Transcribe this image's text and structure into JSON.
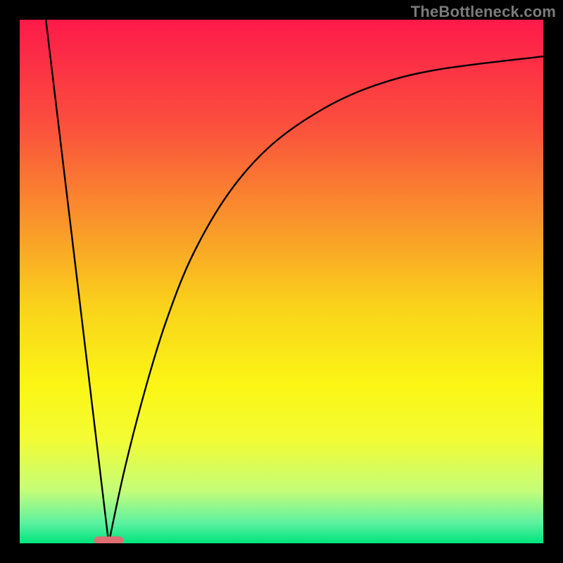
{
  "watermark": "TheBottleneck.com",
  "chart_data": {
    "type": "line",
    "title": "",
    "xlabel": "",
    "ylabel": "",
    "xlim": [
      0,
      100
    ],
    "ylim": [
      0,
      100
    ],
    "optimum_x": 17,
    "series": [
      {
        "name": "left-descent",
        "comment": "Linear segment dropping from top-left down to the optimum point",
        "points": [
          {
            "x": 5.0,
            "y": 100.0
          },
          {
            "x": 17.0,
            "y": 0.0
          }
        ]
      },
      {
        "name": "right-ascent",
        "comment": "Curved segment rising from the optimum toward the upper-right, flattening out near ~93",
        "points": [
          {
            "x": 17.0,
            "y": 0.0
          },
          {
            "x": 20.0,
            "y": 14.0
          },
          {
            "x": 24.0,
            "y": 29.5
          },
          {
            "x": 28.0,
            "y": 42.5
          },
          {
            "x": 33.0,
            "y": 55.0
          },
          {
            "x": 40.0,
            "y": 67.0
          },
          {
            "x": 48.0,
            "y": 76.0
          },
          {
            "x": 58.0,
            "y": 83.0
          },
          {
            "x": 68.0,
            "y": 87.5
          },
          {
            "x": 80.0,
            "y": 90.5
          },
          {
            "x": 100.0,
            "y": 93.0
          }
        ]
      }
    ],
    "optimum_marker": {
      "x_center": 17.0,
      "x_halfwidth": 2.8,
      "y": 0.5,
      "color": "#db6f72"
    },
    "background_gradient": {
      "direction": "vertical",
      "stops": [
        {
          "pos": 0.0,
          "color": "#fd1a4a"
        },
        {
          "pos": 0.2,
          "color": "#fb4f3d"
        },
        {
          "pos": 0.4,
          "color": "#f99a29"
        },
        {
          "pos": 0.55,
          "color": "#fad31b"
        },
        {
          "pos": 0.7,
          "color": "#fbf615"
        },
        {
          "pos": 0.8,
          "color": "#f3fc33"
        },
        {
          "pos": 0.9,
          "color": "#c4fd79"
        },
        {
          "pos": 0.96,
          "color": "#5ef29f"
        },
        {
          "pos": 1.0,
          "color": "#00e47e"
        }
      ]
    }
  }
}
